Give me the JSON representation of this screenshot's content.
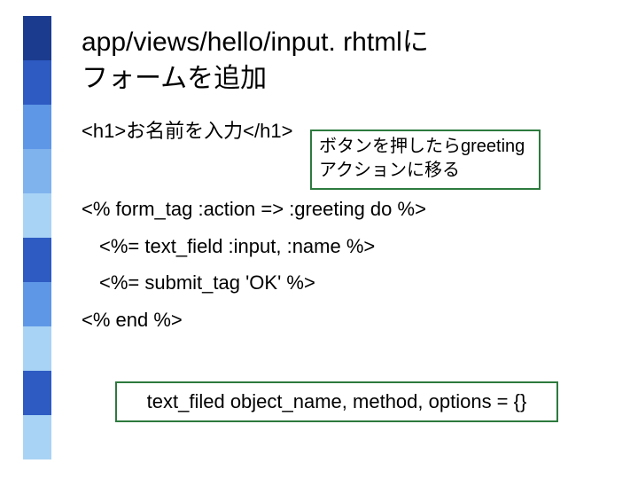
{
  "title": {
    "line1": "app/views/hello/input. rhtmlに",
    "line2": "フォームを追加"
  },
  "codeLines": {
    "l1": "<h1>お名前を入力</h1>",
    "l2": "<% form_tag :action => :greeting do %>",
    "l3": "<%= text_field :input, :name %>",
    "l4": "<%= submit_tag 'OK' %>",
    "l5": "<% end %>"
  },
  "callout1": {
    "line1": "ボタンを押したらgreeting",
    "line2": "アクションに移る"
  },
  "callout2": "text_filed object_name, method, options = {}"
}
